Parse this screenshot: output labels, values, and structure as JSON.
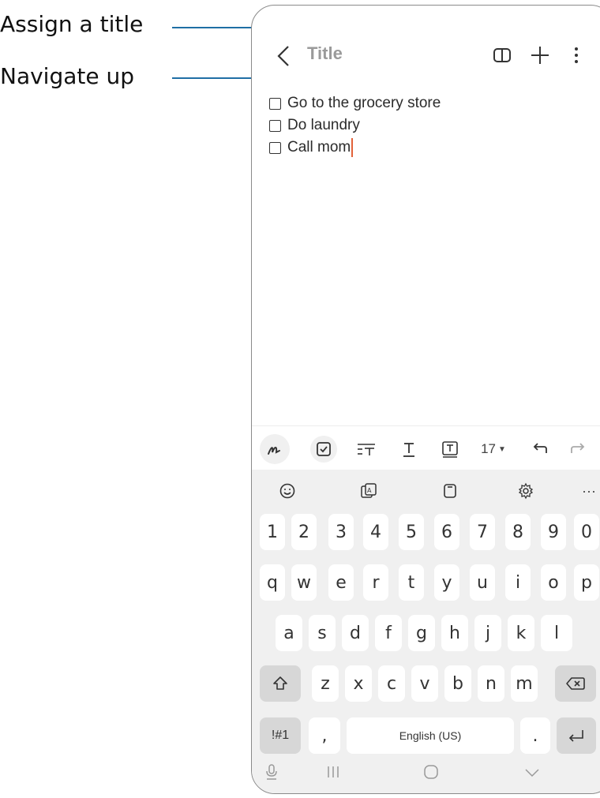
{
  "callouts": {
    "assign_title": "Assign a title",
    "navigate_up": "Navigate up"
  },
  "appbar": {
    "title": "Title",
    "icons": [
      "back-chevron-icon",
      "reading-mode-icon",
      "add-icon",
      "more-options-icon"
    ]
  },
  "notes": [
    {
      "text": "Go to the grocery store"
    },
    {
      "text": "Do laundry"
    },
    {
      "text": "Call mom"
    }
  ],
  "toolbar": {
    "font_size": "17",
    "icons": [
      "handwriting-pen-icon",
      "checkbox-icon",
      "paragraph-style-icon",
      "text-style-icon",
      "text-box-icon",
      "font-size-dropdown",
      "undo-icon",
      "redo-icon"
    ]
  },
  "keyboard_top": {
    "icons": [
      "emoji-icon",
      "translate-icon",
      "clipboard-icon",
      "settings-icon",
      "more-icon"
    ],
    "more": "···"
  },
  "keyboard": {
    "numbers": [
      "1",
      "2",
      "3",
      "4",
      "5",
      "6",
      "7",
      "8",
      "9",
      "0"
    ],
    "row1": [
      "q",
      "w",
      "e",
      "r",
      "t",
      "y",
      "u",
      "i",
      "o",
      "p"
    ],
    "row2": [
      "a",
      "s",
      "d",
      "f",
      "g",
      "h",
      "j",
      "k",
      "l"
    ],
    "row3": [
      "z",
      "x",
      "c",
      "v",
      "b",
      "n",
      "m"
    ],
    "symbols": "!#1",
    "comma": ",",
    "space": "English (US)",
    "period": "."
  },
  "navbar": {
    "icons": [
      "voice-input-icon",
      "recents-icon",
      "home-icon",
      "hide-keyboard-icon"
    ]
  },
  "colors": {
    "callout_line": "#1f6fa5",
    "cursor": "#e2623a",
    "keyboard_bg": "#f0f0f0"
  }
}
